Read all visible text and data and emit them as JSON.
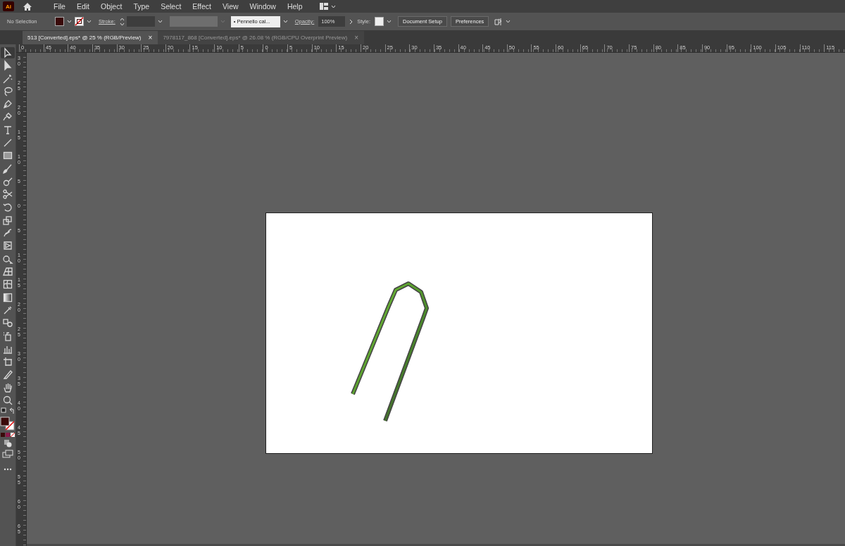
{
  "app_logo": "Ai",
  "menu": [
    "File",
    "Edit",
    "Object",
    "Type",
    "Select",
    "Effect",
    "View",
    "Window",
    "Help"
  ],
  "control_bar": {
    "selection": "No Selection",
    "stroke_label": "Stroke:",
    "brush_marker": "•",
    "brush": "Pennello cal...",
    "opacity_label": "Opacity:",
    "opacity": "100%",
    "style_label": "Style:",
    "buttons": [
      "Document Setup",
      "Preferences"
    ]
  },
  "tabs": [
    {
      "title": "513 [Converted].eps* @ 25 % (RGB/Preview)",
      "close": "×",
      "selected": true
    },
    {
      "title": "7978117_868 [Converted].eps* @ 26.08 % (RGB/CPU Overprint Preview)",
      "close": "×",
      "selected": false
    }
  ],
  "horizontal_ruler": [
    "0",
    "45",
    "40",
    "35",
    "30",
    "25",
    "20",
    "15",
    "10",
    "5",
    "0",
    "5",
    "10",
    "15",
    "20",
    "25",
    "30",
    "35",
    "40",
    "45",
    "50",
    "55",
    "60",
    "65",
    "70",
    "75",
    "80",
    "85",
    "90",
    "95",
    "100",
    "105",
    "110",
    "115"
  ],
  "vertical_ruler": [
    "30",
    "25",
    "20",
    "15",
    "10",
    "5",
    "0",
    "5",
    "10",
    "15",
    "20",
    "25",
    "30",
    "35",
    "40",
    "45",
    "50",
    "55",
    "60",
    "65"
  ],
  "tools": [
    {
      "kind": "selection",
      "selected": true
    },
    {
      "kind": "direct-selection",
      "selected": false
    },
    {
      "kind": "wand",
      "selected": false
    },
    {
      "kind": "lasso",
      "selected": false
    },
    {
      "kind": "pen",
      "selected": false
    },
    {
      "kind": "curvature",
      "selected": false
    },
    {
      "kind": "type",
      "selected": false
    },
    {
      "kind": "line",
      "selected": false
    },
    {
      "kind": "rectangle",
      "selected": false
    },
    {
      "kind": "brush",
      "selected": false
    },
    {
      "kind": "shaper",
      "selected": false
    },
    {
      "kind": "scissors",
      "selected": false
    },
    {
      "kind": "rotate",
      "selected": false
    },
    {
      "kind": "scale",
      "selected": false
    },
    {
      "kind": "warp",
      "selected": false
    },
    {
      "kind": "free-transform",
      "selected": false
    },
    {
      "kind": "shape-builder",
      "selected": false
    },
    {
      "kind": "perspective",
      "selected": false
    },
    {
      "kind": "mesh",
      "selected": false
    },
    {
      "kind": "gradient",
      "selected": false
    },
    {
      "kind": "eyedropper",
      "selected": false
    },
    {
      "kind": "blend",
      "selected": false
    },
    {
      "kind": "sprayer",
      "selected": false
    },
    {
      "kind": "graph",
      "selected": false
    },
    {
      "kind": "artboard",
      "selected": false
    },
    {
      "kind": "slice",
      "selected": false
    },
    {
      "kind": "hand",
      "selected": false
    },
    {
      "kind": "zoom",
      "selected": false
    }
  ]
}
